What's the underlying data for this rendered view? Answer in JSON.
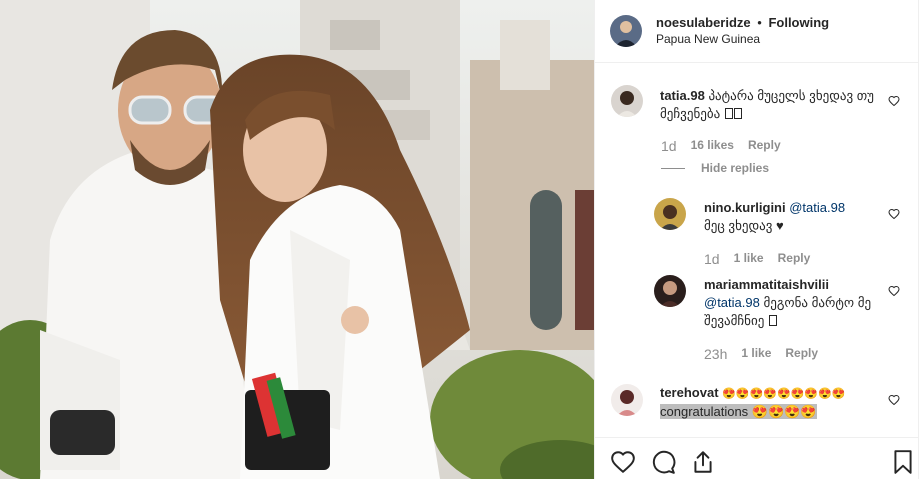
{
  "post": {
    "author": "noesulaberidze",
    "separator": "•",
    "follow_state": "Following",
    "location": "Papua New Guinea"
  },
  "comments": [
    {
      "user": "tatia.98",
      "text": "პატარა მუცელს ვხედავ თუ მეჩვენება",
      "time": "1d",
      "likes": "16 likes",
      "reply": "Reply",
      "hide_replies": "Hide replies"
    },
    {
      "user": "nino.kurligini",
      "mention": "@tatia.98",
      "text": "მეც ვხედავ ♥",
      "time": "1d",
      "likes": "1 like",
      "reply": "Reply"
    },
    {
      "user": "mariammatitaishvilii",
      "mention": "@tatia.98",
      "text": "მეგონა მარტო მე შევამჩნიე",
      "time": "23h",
      "likes": "1 like",
      "reply": "Reply"
    },
    {
      "user": "terehovat",
      "text": "😍😍😍😍😍😍😍😍😍",
      "text2": "congratulations 😍😍😍😍"
    }
  ],
  "icons": {
    "like": "heart-icon",
    "comment": "comment-icon",
    "share": "share-icon",
    "save": "bookmark-icon"
  },
  "colors": {
    "mention": "#003569",
    "muted": "#8e8e8e",
    "text": "#262626",
    "border": "#efefef"
  }
}
